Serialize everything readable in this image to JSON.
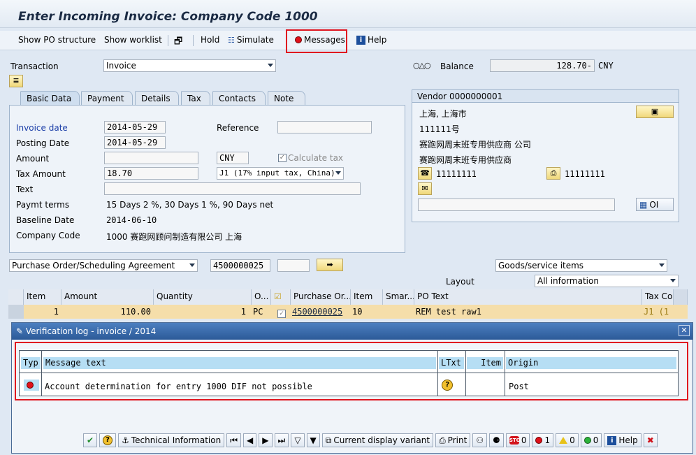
{
  "title": "Enter Incoming Invoice: Company Code 1000",
  "toolbar": {
    "show_po_structure": "Show PO structure",
    "show_worklist": "Show worklist",
    "hold": "Hold",
    "simulate": "Simulate",
    "messages": "Messages",
    "help": "Help"
  },
  "header": {
    "transaction_label": "Transaction",
    "transaction_value": "Invoice",
    "balance_label": "Balance",
    "balance_value": "128.70-",
    "balance_currency": "CNY"
  },
  "tabs": [
    "Basic Data",
    "Payment",
    "Details",
    "Tax",
    "Contacts",
    "Note"
  ],
  "basic": {
    "invoice_date_label": "Invoice date",
    "invoice_date": "2014-05-29",
    "reference_label": "Reference",
    "reference": "",
    "posting_date_label": "Posting Date",
    "posting_date": "2014-05-29",
    "amount_label": "Amount",
    "amount": "",
    "currency": "CNY",
    "calculate_tax": "Calculate tax",
    "tax_amount_label": "Tax Amount",
    "tax_amount": "18.70",
    "tax_code": "J1 (17% input tax, China)",
    "text_label": "Text",
    "text": "",
    "paymt_terms_label": "Paymt terms",
    "paymt_terms": "15 Days 2 %, 30 Days 1 %, 90 Days net",
    "baseline_date_label": "Baseline Date",
    "baseline_date": "2014-06-10",
    "company_code_label": "Company Code",
    "company_code": "1000 赛跑网顾问制造有限公司 上海"
  },
  "vendor": {
    "title": "Vendor 0000000001",
    "line1": "上海, 上海市",
    "line2": "111111号",
    "line3": "赛跑网周末班专用供应商 公司",
    "line4": "赛跑网周末班专用供应商",
    "phone": "11111111",
    "fax": "11111111",
    "oi": "OI"
  },
  "reference_doc": {
    "type": "Purchase Order/Scheduling Agreement",
    "number": "4500000025",
    "item": "",
    "goods_service": "Goods/service items",
    "layout_label": "Layout",
    "layout": "All information"
  },
  "grid": {
    "headers": [
      "Item",
      "Amount",
      "Quantity",
      "O...",
      "",
      "Purchase Or...",
      "Item",
      "Smar...",
      "PO Text",
      "Tax Cod"
    ],
    "row": {
      "item": "1",
      "amount": "110.00",
      "quantity": "1",
      "unit": "PC",
      "po": "4500000025",
      "po_item": "10",
      "po_text": "REM test raw1",
      "tax": "J1 (1"
    }
  },
  "dialog": {
    "title": "Verification log - invoice  / 2014",
    "headers": {
      "typ": "Typ",
      "message": "Message text",
      "ltxt": "LTxt",
      "item": "Item",
      "origin": "Origin"
    },
    "message": {
      "text": "Account determination for entry 1000 DIF not possible",
      "item": "",
      "origin": "Post"
    },
    "buttons": {
      "technical": "Technical Information",
      "current_variant": "Current display variant",
      "print": "Print",
      "stop_count": "0",
      "error_count": "1",
      "warning_count": "0",
      "success_count": "0",
      "help": "Help"
    }
  }
}
